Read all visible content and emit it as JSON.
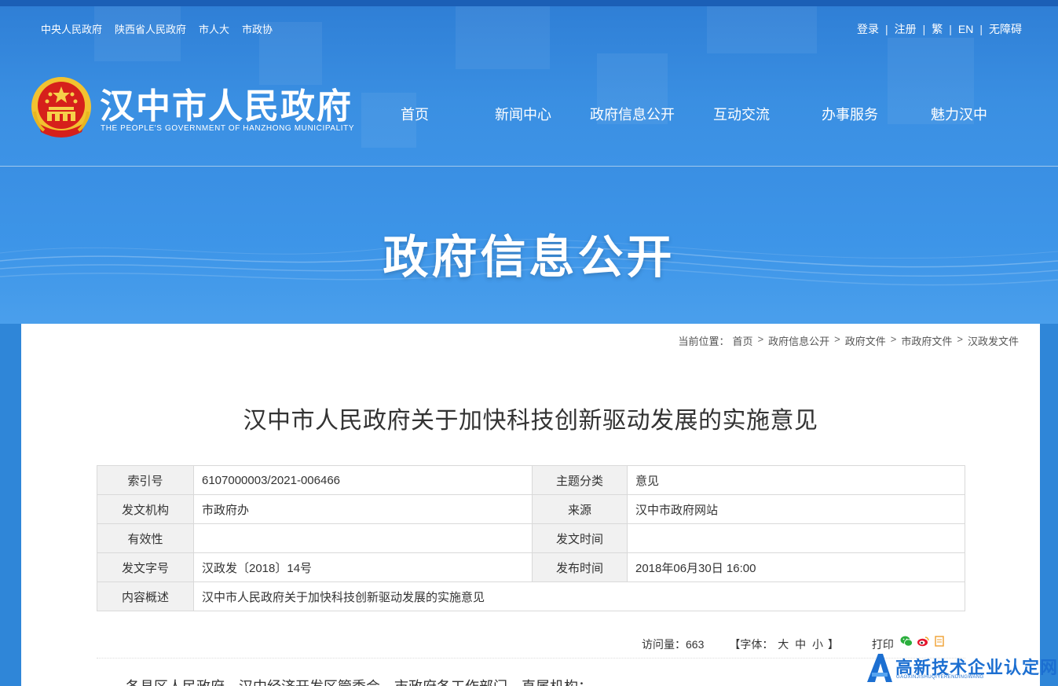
{
  "top_links": [
    "中央人民政府",
    "陕西省人民政府",
    "市人大",
    "市政协"
  ],
  "user_links": [
    "登录",
    "注册",
    "繁",
    "EN",
    "无障碍"
  ],
  "site": {
    "title": "汉中市人民政府",
    "subtitle": "THE PEOPLE'S GOVERNMENT OF HANZHONG MUNICIPALITY"
  },
  "nav": [
    "首页",
    "新闻中心",
    "政府信息公开",
    "互动交流",
    "办事服务",
    "魅力汉中"
  ],
  "banner_title": "政府信息公开",
  "breadcrumb": {
    "prefix": "当前位置：",
    "items": [
      "首页",
      "政府信息公开",
      "政府文件",
      "市政府文件",
      "汉政发文件"
    ]
  },
  "doc_title": "汉中市人民政府关于加快科技创新驱动发展的实施意见",
  "meta": {
    "index_no_label": "索引号",
    "index_no": "6107000003/2021-006466",
    "category_label": "主题分类",
    "category": "意见",
    "issuer_label": "发文机构",
    "issuer": "市政府办",
    "source_label": "来源",
    "source": "汉中市政府网站",
    "validity_label": "有效性",
    "validity": "",
    "issue_time_label": "发文时间",
    "issue_time": "",
    "doc_no_label": "发文字号",
    "doc_no": "汉政发〔2018〕14号",
    "publish_time_label": "发布时间",
    "publish_time": "2018年06月30日 16:00",
    "summary_label": "内容概述",
    "summary": "汉中市人民政府关于加快科技创新驱动发展的实施意见"
  },
  "tools": {
    "visits": "访问量：663",
    "font_prefix": "【字体：",
    "font_large": "大",
    "font_medium": "中",
    "font_small": "小",
    "font_suffix": "】",
    "print": "打印"
  },
  "share_icons": [
    "wechat-icon",
    "weibo-icon",
    "copy-icon"
  ],
  "body_text": "各县区人民政府，汉中经济开发区管委会，市政府各工作部门、直属机构：",
  "watermark": {
    "text": "高新技术企业认定网",
    "sub": "GAOXINJISHUQIYERENDINGWANG"
  },
  "colors": {
    "header_blue": "#2f7fd6",
    "watermark_blue": "#1c6fd1",
    "emblem_red": "#d6201b",
    "emblem_gold": "#f2c230"
  }
}
